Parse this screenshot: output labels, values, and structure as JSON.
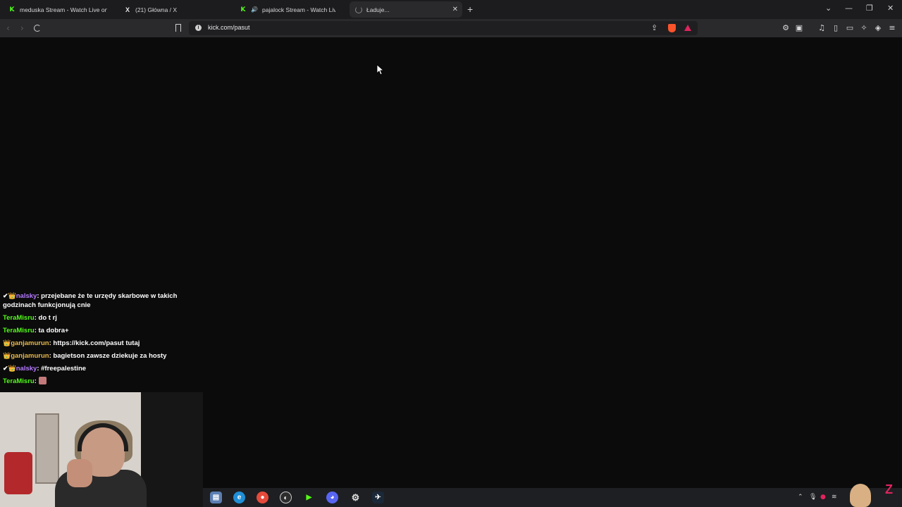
{
  "browser": {
    "tabs": [
      {
        "title": "meduska Stream - Watch Live on Kick",
        "favicon": "kick-icon",
        "active": false
      },
      {
        "title": "(21) Główna / X",
        "favicon": "x-icon",
        "active": false
      },
      {
        "title": "pajalock Stream - Watch Live on Kick",
        "favicon": "kick-icon",
        "audio": true,
        "active": false
      },
      {
        "title": "Ładuje...",
        "favicon": "loading-spinner-icon",
        "active": true
      }
    ],
    "new_tab_label": "+",
    "url": "kick.com/pasut"
  },
  "chat": {
    "messages": [
      {
        "badges": "✔👑",
        "user": "nalsky",
        "user_color": "#b57bff",
        "text": "przejebane że te urzędy skarbowe w takich godzinach funkcjonują cnie"
      },
      {
        "badges": "",
        "user": "TeraMisru",
        "user_color": "#53fc18",
        "text": "do t rj"
      },
      {
        "badges": "",
        "user": "TeraMisru",
        "user_color": "#53fc18",
        "text": "ta dobra+"
      },
      {
        "badges": "👑",
        "user": "ganjamurun",
        "user_color": "#e9b949",
        "text": "https://kick.com/pasut tutaj"
      },
      {
        "badges": "👑",
        "user": "ganjamurun",
        "user_color": "#e9b949",
        "text": "bagietson zawsze dziekuje za hosty"
      },
      {
        "badges": "✔👑",
        "user": "nalsky",
        "user_color": "#b57bff",
        "text": "#freepalestine"
      },
      {
        "badges": "",
        "user": "TeraMisru",
        "user_color": "#53fc18",
        "text": "",
        "emote": true
      }
    ]
  },
  "colors": {
    "kick_green": "#53fc18",
    "background": "#0b0b0c",
    "toolbar": "#2a2a2d"
  },
  "taskbar": {
    "icons": [
      "explorer-icon",
      "edge-icon",
      "chrome-icon",
      "obs-icon",
      "media-player-icon",
      "discord-icon",
      "settings-icon",
      "steam-icon"
    ]
  }
}
